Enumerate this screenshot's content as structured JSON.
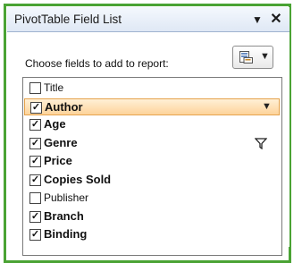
{
  "pane": {
    "title": "PivotTable Field List",
    "dropdown_glyph": "▼",
    "close_glyph": "✕",
    "choose_label": "Choose fields to add to report:",
    "layout_button_icon": "field-list-layout-icon",
    "layout_button_arrow": "▼"
  },
  "fields": [
    {
      "label": "Title",
      "checked": false,
      "bold": false
    },
    {
      "label": "Author",
      "checked": true,
      "bold": true,
      "selected": true,
      "has_dropdown": true
    },
    {
      "label": "Age",
      "checked": true,
      "bold": true
    },
    {
      "label": "Genre",
      "checked": true,
      "bold": true,
      "filtered": true
    },
    {
      "label": "Price",
      "checked": true,
      "bold": true
    },
    {
      "label": "Copies Sold",
      "checked": true,
      "bold": true
    },
    {
      "label": "Publisher",
      "checked": false,
      "bold": false
    },
    {
      "label": "Branch",
      "checked": true,
      "bold": true
    },
    {
      "label": "Binding",
      "checked": true,
      "bold": true
    }
  ],
  "colors": {
    "frame_highlight": "#4aa334",
    "selection_fill": "#fdd39a",
    "selection_border": "#e5a34d"
  }
}
